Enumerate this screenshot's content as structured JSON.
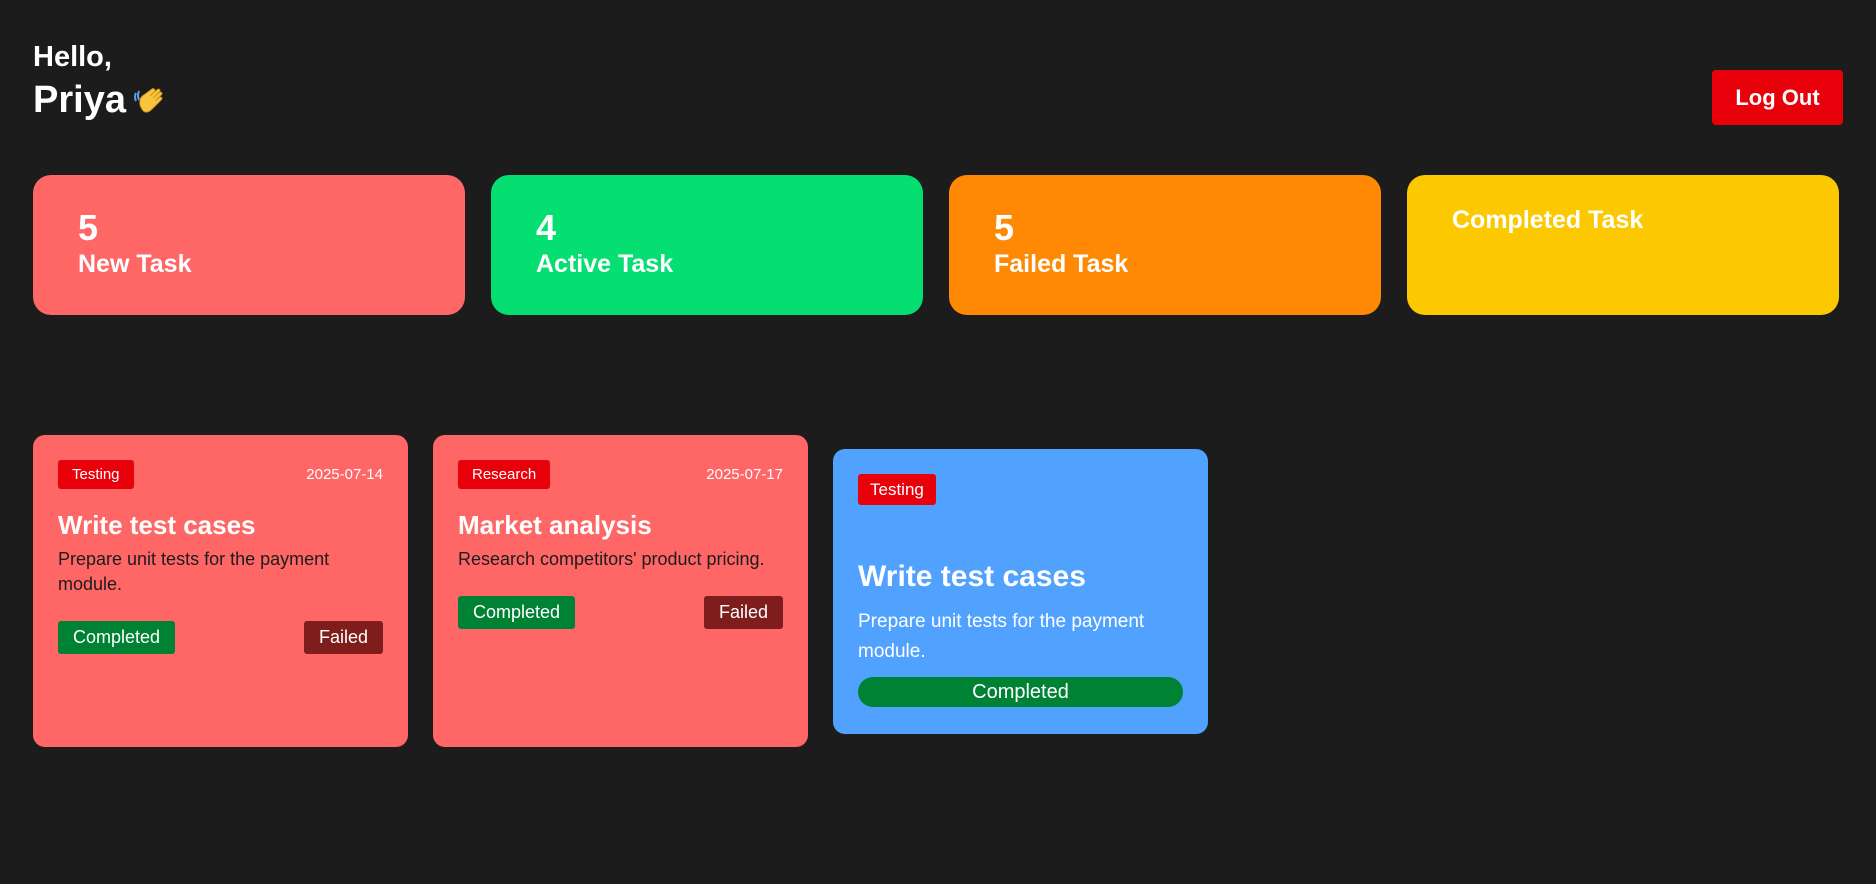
{
  "header": {
    "hello": "Hello,",
    "name": "Priya",
    "wave_icon": "waving-hand-icon",
    "logout_label": "Log Out"
  },
  "stats": [
    {
      "count": "5",
      "label": "New Task",
      "color": "#ff6666"
    },
    {
      "count": "4",
      "label": "Active Task",
      "color": "#05df72"
    },
    {
      "count": "5",
      "label": "Failed Task",
      "color": "#ff8904"
    },
    {
      "count": "",
      "label": "Completed Task",
      "color": "#fcc800"
    }
  ],
  "tasks": [
    {
      "category": "Testing",
      "date": "2025-07-14",
      "title": "Write test cases",
      "description": "Prepare unit tests for the payment module.",
      "completed_label": "Completed",
      "failed_label": "Failed",
      "color": "#ff6666"
    },
    {
      "category": "Research",
      "date": "2025-07-17",
      "title": "Market analysis",
      "description": "Research competitors' product pricing.",
      "completed_label": "Completed",
      "failed_label": "Failed",
      "color": "#ff6666"
    },
    {
      "category": "Testing",
      "title": "Write test cases",
      "description": "Prepare unit tests for the payment module.",
      "status_label": "Completed",
      "color": "#51a2ff"
    }
  ],
  "colors": {
    "background": "#1c1c1c",
    "badge": "#e8000b",
    "completed": "#008234",
    "failed": "#7f1d1d"
  }
}
